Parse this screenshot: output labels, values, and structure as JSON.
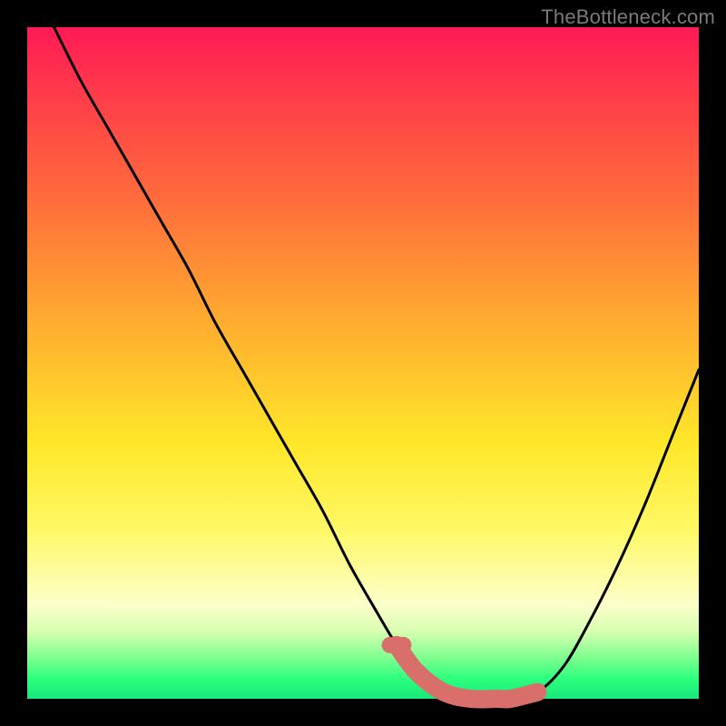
{
  "watermark": "TheBottleneck.com",
  "colors": {
    "background": "#000000",
    "curve": "#000000",
    "highlight": "#d86f6a",
    "gradient_stops": [
      "#ff1a55",
      "#ff3b4a",
      "#ff6a3c",
      "#ffb02f",
      "#ffe72a",
      "#fff966",
      "#fdffcb",
      "#d7ffb0",
      "#7cff8e",
      "#2dff7f",
      "#18e879"
    ]
  },
  "chart_data": {
    "type": "line",
    "title": "",
    "xlabel": "",
    "ylabel": "",
    "xlim": [
      0,
      100
    ],
    "ylim": [
      0,
      100
    ],
    "grid": false,
    "series": [
      {
        "name": "bottleneck_curve",
        "x": [
          4,
          8,
          12,
          16,
          20,
          24,
          28,
          32,
          36,
          40,
          44,
          48,
          52,
          55,
          58,
          62,
          66,
          70,
          72,
          76,
          80,
          84,
          88,
          92,
          96,
          100
        ],
        "values": [
          100,
          92,
          85,
          78,
          71,
          64,
          56,
          49,
          42,
          35,
          28,
          20,
          13,
          8,
          4,
          1,
          0,
          0,
          0,
          1,
          5,
          12,
          20,
          29,
          39,
          49
        ]
      }
    ],
    "highlight_segment": {
      "series": "bottleneck_curve",
      "x_start": 55,
      "x_end": 77,
      "note": "thick coral overlay along the valley"
    },
    "highlight_dots": {
      "series": "bottleneck_curve",
      "x": [
        54,
        56
      ]
    },
    "legend": false
  }
}
